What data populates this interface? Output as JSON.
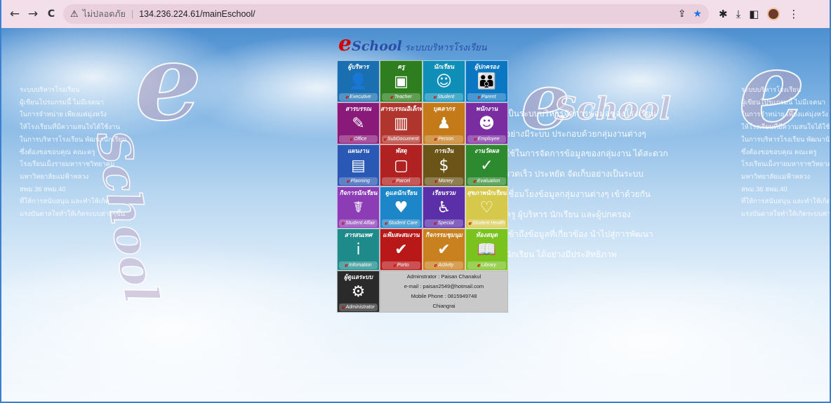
{
  "browser": {
    "back": "←",
    "forward": "→",
    "reload": "C",
    "insecure_label": "ไม่ปลอดภัย",
    "url": "134.236.224.61/mainEschool/",
    "icons": [
      "share-icon",
      "star-icon",
      "extensions-icon",
      "download-icon",
      "sidepanel-icon",
      "avatar",
      "menu-icon"
    ]
  },
  "logo": {
    "e": "e",
    "school": "School",
    "thai": "ระบบบริหารโรงเรียน"
  },
  "side_text": [
    "ระบบบริหารโรงเรียน",
    "ผู้เขียนโปรแกรมนี้ ไม่มีเจตนา",
    "ในการจำหน่าย เพียงแค่มุ่งหวัง",
    "ให้โรงเรียนที่มีความสนใจได้ใช้งาน",
    "ในการบริหารโรงเรียน พัฒนานักเรียน",
    "ซึ่งต้องขอขอบคุณ คณะครู",
    "โรงเรียนเม็งรายมหาราชวิทยาคม",
    "มหาวิทยาลัยแม่ฟ้าหลวง",
    "สพม.36 สพม.40",
    "ที่ให้การสนับสนุน และทำให้เกิด",
    "แรงบันดาลใจทำให้เกิดระบบต่างๆขึ้น"
  ],
  "description": [
    "เป็นระบบบริหารจัดการข้อมูลของโรงเรียน",
    "อย่างมีระบบ ประกอบด้วยกลุ่มงานต่างๆ",
    "ใช้ในการจัดการข้อมูลของกลุ่มงาน ได้สะดวก",
    "รวดเร็ว ประหยัด จัดเก็บอย่างเป็นระบบ",
    "เชื่อมโยงข้อมูลกลุ่มงานต่างๆ เข้าด้วยกัน",
    "ครู ผู้บริหาร นักเรียน และผู้ปกครอง",
    "เข้าถึงข้อมูลที่เกี่ยวข้อง นำไปสู่การพัฒนา",
    "นักเรียน ได้อย่างมีประสิทธิภาพ"
  ],
  "tiles": [
    {
      "title": "ผู้บริหาร",
      "foot": "Executive",
      "icon": "👤",
      "color": "#1a6fb0",
      "name": "executive-tile"
    },
    {
      "title": "ครู",
      "foot": "Teacher",
      "icon": "▣",
      "color": "#2e7d1e",
      "name": "teacher-tile"
    },
    {
      "title": "นักเรียน",
      "foot": "Student",
      "icon": "☺",
      "color": "#0f8fb8",
      "name": "student-tile"
    },
    {
      "title": "ผู้ปกครอง",
      "foot": "Parent",
      "icon": "👪",
      "color": "#0b76c2",
      "name": "parent-tile"
    },
    {
      "title": "สารบรรณ",
      "foot": "Office",
      "icon": "✎",
      "color": "#8a1a7a",
      "name": "office-tile"
    },
    {
      "title": "สารบรรณอิเล็กทรอนิกส์",
      "foot": "SubDocument",
      "icon": "▥",
      "color": "#b0352d",
      "name": "subdocument-tile"
    },
    {
      "title": "บุคลากร",
      "foot": "Person",
      "icon": "♟",
      "color": "#c47a18",
      "name": "person-tile"
    },
    {
      "title": "พนักงาน",
      "foot": "Employee",
      "icon": "☻",
      "color": "#7a2da0",
      "name": "employee-tile"
    },
    {
      "title": "แผนงาน",
      "foot": "Planning",
      "icon": "▤",
      "color": "#2a58b5",
      "name": "planning-tile"
    },
    {
      "title": "พัสดุ",
      "foot": "Parcel",
      "icon": "▢",
      "color": "#b02222",
      "name": "parcel-tile"
    },
    {
      "title": "การเงิน",
      "foot": "Money",
      "icon": "$",
      "color": "#6a5418",
      "name": "money-tile"
    },
    {
      "title": "งานวัดผล",
      "foot": "Evaluation",
      "icon": "✓",
      "color": "#2e8a2e",
      "name": "evaluation-tile"
    },
    {
      "title": "กิจการนักเรียน",
      "foot": "Student Affair",
      "icon": "☤",
      "color": "#8c3db5",
      "name": "student-affair-tile"
    },
    {
      "title": "ดูแลนักเรียน",
      "foot": "Student Care",
      "icon": "♥",
      "color": "#1c86c9",
      "name": "student-care-tile"
    },
    {
      "title": "เรียนรวม",
      "foot": "Special",
      "icon": "♿",
      "color": "#5a2fa8",
      "name": "special-tile"
    },
    {
      "title": "สุขภาพนักเรียน",
      "foot": "Student Health",
      "icon": "♡",
      "color": "#d6c84a",
      "name": "student-health-tile"
    },
    {
      "title": "สารสนเทศ",
      "foot": "Infomation",
      "icon": "i",
      "color": "#1e8a8a",
      "name": "infomation-tile"
    },
    {
      "title": "แฟ้มสะสมงาน",
      "foot": "Porto",
      "icon": "✔",
      "color": "#b81818",
      "name": "porto-tile"
    },
    {
      "title": "กิจกรรมชุมนุม",
      "foot": "Activity",
      "icon": "✔",
      "color": "#c9801e",
      "name": "activity-tile"
    },
    {
      "title": "ห้องสมุด",
      "foot": "Library",
      "icon": "📖",
      "color": "#7ac21e",
      "name": "library-tile"
    }
  ],
  "admin_tile": {
    "title": "ผู้ดูแลระบบ",
    "foot": "Administrator",
    "icon": "⚙",
    "color": "#2a2a2a"
  },
  "info": {
    "admin": "Adminstrator : Paisan Chanakul",
    "email": "e-mail : paisan2549@hotmail.com",
    "phone": "Mobile Phone : 0815949748",
    "city": "Chiangrai"
  }
}
